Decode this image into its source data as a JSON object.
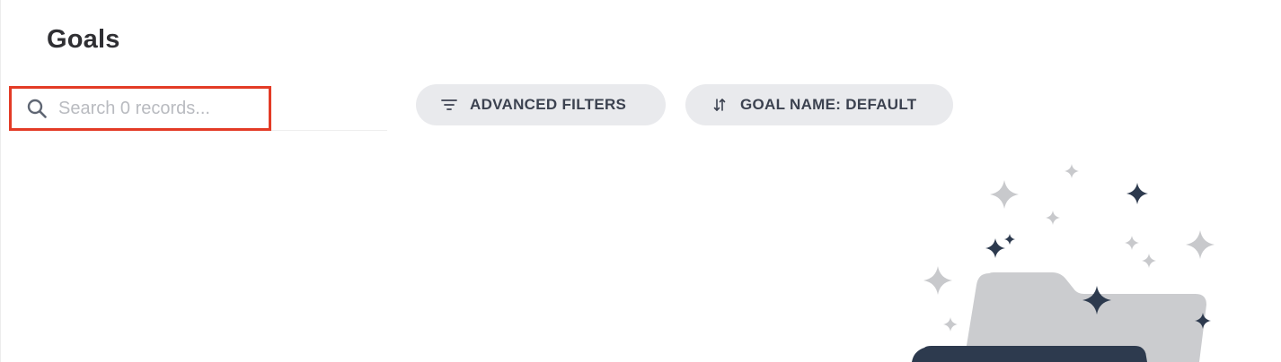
{
  "page": {
    "title": "Goals"
  },
  "search": {
    "placeholder": "Search 0 records...",
    "value": "",
    "highlight_color": "#e33b26"
  },
  "toolbar": {
    "advanced_filters_label": "ADVANCED FILTERS",
    "advanced_filters_icon": "filter-lines-icon",
    "sort_label": "GOAL NAME: DEFAULT",
    "sort_icon": "sort-arrows-icon"
  },
  "empty_state": {
    "illustration": "folder-with-sparkles-icon"
  },
  "colors": {
    "pill_background": "#e9eaed",
    "text_dark": "#2f2f33",
    "sparkle_dark": "#2d3a4e",
    "sparkle_light": "#c8c9cc",
    "folder": "#cbcccf"
  }
}
